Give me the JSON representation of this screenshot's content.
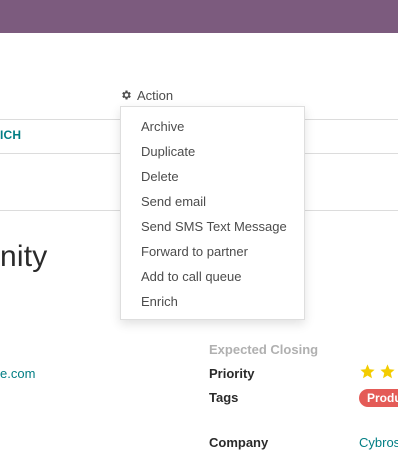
{
  "header": {
    "action_label": "Action"
  },
  "statusbar": {
    "button_label": "ICH"
  },
  "record": {
    "title": "nity",
    "email": "e.com"
  },
  "fields": {
    "expected_closing_label": "Expected Closing",
    "priority_label": "Priority",
    "priority_value": "2 of 2 visible stars filled",
    "tags_label": "Tags",
    "tag_value": "Produ",
    "company_label": "Company",
    "company_value": "Cybros"
  },
  "action_menu": {
    "items": [
      {
        "label": "Archive"
      },
      {
        "label": "Duplicate"
      },
      {
        "label": "Delete"
      },
      {
        "label": "Send email"
      },
      {
        "label": "Send SMS Text Message"
      },
      {
        "label": "Forward to partner"
      },
      {
        "label": "Add to call queue"
      },
      {
        "label": "Enrich"
      }
    ]
  },
  "colors": {
    "topbar": "#7c5b7e",
    "link": "#017e84",
    "star": "#f3cc00",
    "tag": "#e45b57"
  },
  "icons": {
    "action": "gear-icon",
    "priority": "star-icon"
  }
}
